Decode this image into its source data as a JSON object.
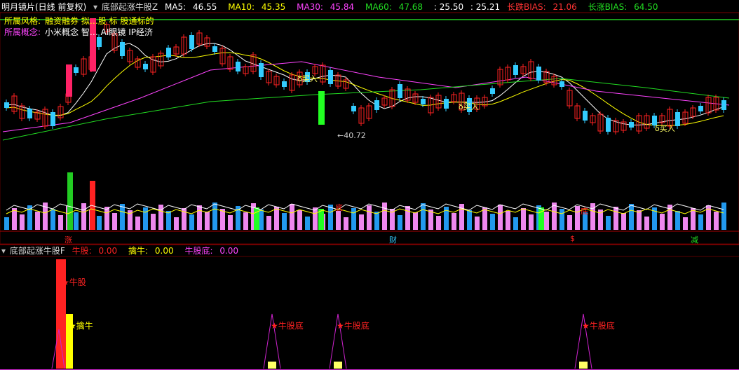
{
  "title": "明月镜片(日线 前复权)",
  "main_indicator": {
    "name": "底部起涨牛股Z",
    "ma5_label": "MA5:",
    "ma5": "46.55",
    "ma10_label": "MA10:",
    "ma10": "45.35",
    "ma30_label": "MA30:",
    "ma30": "45.84",
    "ma60_label": "MA60:",
    "ma60": "47.68",
    "v1": ": 25.50",
    "v2": ": 25.21",
    "bias_long_label": "长跌BIAS:",
    "bias_long": "21.06",
    "bias_up_label": "长涨BIAS:",
    "bias_up": "64.50"
  },
  "sector": {
    "style_label": "所属风格:",
    "style_value": "融资融券 拟…股 标 股通标的",
    "concept_label": "所属概念:",
    "concept_value": "小米概念 智… AI眼镜 IP经济"
  },
  "annotations": {
    "buy": "买入",
    "low_price": "←40.72",
    "tag_zhang": "涨",
    "tag_cai": "财",
    "tag_s": "$",
    "tag_jian": "减",
    "di": "底"
  },
  "indicator": {
    "name": "底部起涨牛股F",
    "niugu_label": "牛股:",
    "niugu": "0.00",
    "qiniu_label": "擒牛:",
    "qiniu": "0.00",
    "niugudi_label": "牛股底:",
    "niugudi": "0.00",
    "sig_niugu": "牛股",
    "sig_qiniu": "擒牛",
    "sig_niugudi": "牛股底"
  },
  "colors": {
    "up": "#ff2222",
    "down": "#33ccff",
    "ma5": "#ffffff",
    "ma10": "#ffff00",
    "ma30": "#ff44ff",
    "ma60": "#22dd22"
  }
}
